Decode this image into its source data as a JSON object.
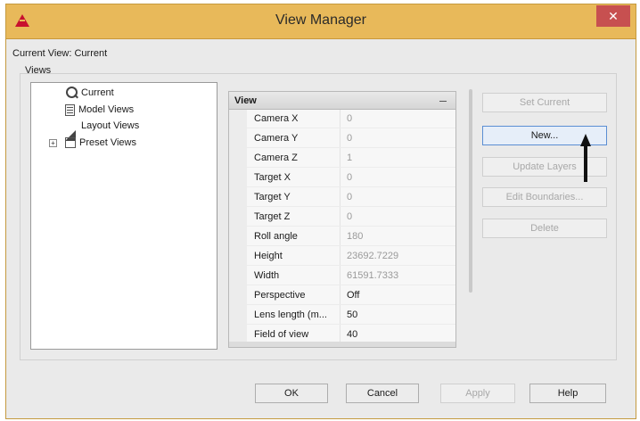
{
  "window": {
    "title": "View Manager",
    "close_glyph": "✕"
  },
  "current_view": "Current View: Current",
  "views_label": "Views",
  "tree": {
    "items": [
      {
        "label": "Current",
        "icon": "camera-icon"
      },
      {
        "label": "Model Views",
        "icon": "model-views-icon"
      },
      {
        "label": "Layout Views",
        "icon": "layout-views-icon"
      },
      {
        "label": "Preset Views",
        "icon": "preset-views-icon",
        "expander": "+"
      }
    ]
  },
  "properties": {
    "header": "View",
    "rows": [
      {
        "name": "Camera X",
        "value": "0"
      },
      {
        "name": "Camera Y",
        "value": "0"
      },
      {
        "name": "Camera Z",
        "value": "1"
      },
      {
        "name": "Target X",
        "value": "0"
      },
      {
        "name": "Target Y",
        "value": "0"
      },
      {
        "name": "Target Z",
        "value": "0"
      },
      {
        "name": "Roll angle",
        "value": "180"
      },
      {
        "name": "Height",
        "value": "23692.7229"
      },
      {
        "name": "Width",
        "value": "61591.7333"
      },
      {
        "name": "Perspective",
        "value": "Off"
      },
      {
        "name": "Lens length (m...",
        "value": "50"
      },
      {
        "name": "Field of view",
        "value": "40"
      }
    ]
  },
  "side_buttons": {
    "set_current": "Set Current",
    "new": "New...",
    "update_layers": "Update Layers",
    "edit_boundaries": "Edit Boundaries...",
    "delete": "Delete"
  },
  "bottom_buttons": {
    "ok": "OK",
    "cancel": "Cancel",
    "apply": "Apply",
    "help": "Help"
  },
  "colors": {
    "titlebar": "#e8b95a",
    "close": "#c75050",
    "focus_border": "#5b8ed3"
  }
}
